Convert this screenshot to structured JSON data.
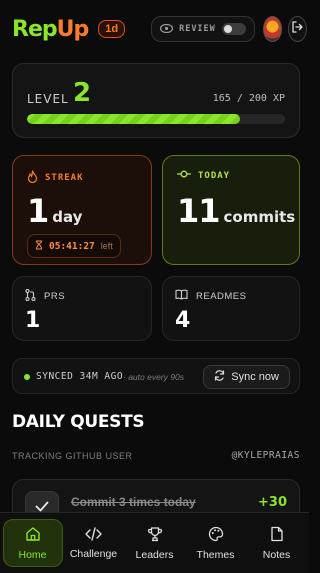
{
  "header": {
    "logo_part1": "Rep",
    "logo_part2": "Up",
    "day_badge": "1d",
    "review_label": "REVIEW",
    "review_toggle_on": false
  },
  "level": {
    "label": "LEVEL",
    "value": "2",
    "xp_text": "165 / 200 XP",
    "progress_fraction": 0.825
  },
  "streak": {
    "label": "STREAK",
    "value": "1",
    "unit": "day",
    "timer": "05:41:27",
    "timer_suffix": "left"
  },
  "today": {
    "label": "TODAY",
    "value": "11",
    "unit": "commits"
  },
  "prs": {
    "label": "PRS",
    "value": "1"
  },
  "readmes": {
    "label": "READMES",
    "value": "4"
  },
  "sync": {
    "status": "SYNCED 34M AGO",
    "sub": "· auto every 90s",
    "button": "Sync now"
  },
  "quests": {
    "title": "DAILY QUESTS",
    "tracking": "TRACKING GITHUB USER",
    "handle": "@KYLEPRAIAS",
    "items": [
      {
        "text": "Commit 3 times today",
        "xp": "+30",
        "done": true
      }
    ]
  },
  "nav": {
    "items": [
      {
        "label": "Home",
        "icon": "home-icon",
        "active": true
      },
      {
        "label": "Challenge",
        "icon": "code-icon",
        "active": false
      },
      {
        "label": "Leaders",
        "icon": "trophy-icon",
        "active": false
      },
      {
        "label": "Themes",
        "icon": "palette-icon",
        "active": false
      },
      {
        "label": "Notes",
        "icon": "note-icon",
        "active": false
      }
    ]
  },
  "colors": {
    "accent_green": "#8ae62a",
    "accent_orange": "#ff7a2a",
    "background": "#0b0b0b"
  }
}
